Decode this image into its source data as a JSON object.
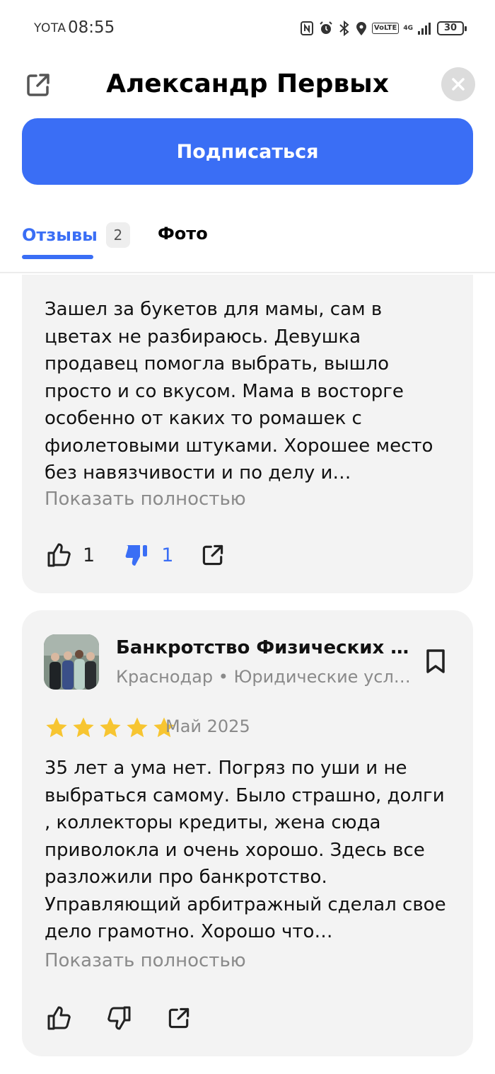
{
  "status_bar": {
    "carrier": "YOTA",
    "time": "08:55",
    "volte": "VoLTE",
    "network": "4G",
    "battery": "30"
  },
  "header": {
    "title": "Александр Первых",
    "share_icon": "external-link-icon",
    "close_icon": "close-icon"
  },
  "subscribe_label": "Подписаться",
  "tabs": {
    "reviews_label": "Отзывы",
    "reviews_count": "2",
    "photo_label": "Фото"
  },
  "reviews": [
    {
      "text": "Зашел за букетов для мамы, сам в цветах не разбираюсь. Девушка продавец помогла выбрать, вышло просто и со вкусом. Мама в восторге особенно от каких то ромашек с фиолетовыми штуками. Хорошее место без навязчивости и по делу и…",
      "show_full": "Показать полностью",
      "likes": "1",
      "dislikes": "1"
    },
    {
      "org_name": "Банкротство Физических …",
      "org_sub": "Краснодар • Юридические усл…",
      "rating": 5,
      "date": "Май 2025",
      "text": "35 лет а ума нет. Погряз по уши и не выбраться самому. Было страшно, долги , коллекторы кредиты, жена сюда приволокла и очень хорошо. Здесь все разложили про банкротство. Управляющий арбитражный сделал свое дело грамотно. Хорошо что…",
      "show_full": "Показать полностью"
    }
  ],
  "colors": {
    "accent": "#3a6ef5",
    "star": "#f7c531",
    "card_bg": "#f3f3f3"
  }
}
